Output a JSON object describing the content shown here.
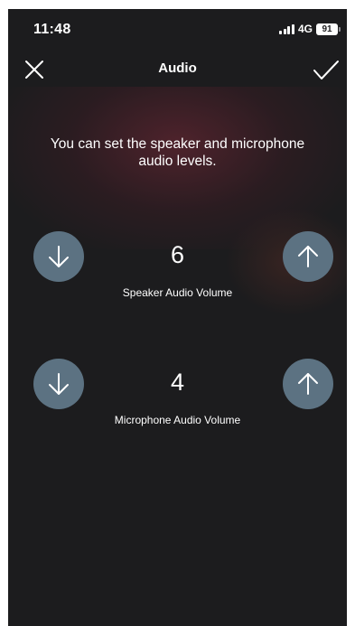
{
  "status_bar": {
    "time": "11:48",
    "network": "4G",
    "battery": "91"
  },
  "nav": {
    "title": "Audio",
    "close_icon": "close-icon",
    "confirm_icon": "checkmark-icon"
  },
  "intro_text": "You can set the speaker and microphone audio levels.",
  "speaker": {
    "value": "6",
    "label": "Speaker Audio Volume"
  },
  "microphone": {
    "value": "4",
    "label": "Microphone Audio Volume"
  },
  "colors": {
    "background": "#1c1c1e",
    "button": "#5c7282",
    "text": "#ffffff"
  }
}
